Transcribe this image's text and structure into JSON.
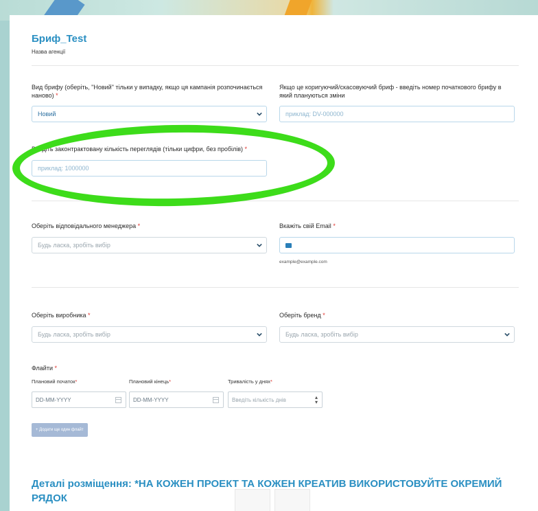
{
  "form": {
    "title": "Бриф_Test",
    "agency_label": "Назва агенції",
    "brief_type": {
      "label": "Вид брифу (оберіть, \"Новий\" тільки у випадку, якщо ця кампанія розпочинається наново)",
      "value": "Новий"
    },
    "corrective_number": {
      "label": "Якщо це коригуючий/скасовуючий бриф - введіть номер початкового брифу в який плануються зміни",
      "placeholder": "приклад: DV-000000"
    },
    "views": {
      "label": "Введіть законтрактовану кількість переглядів (тільки цифри, без пробілів)",
      "placeholder": "приклад: 1000000"
    },
    "manager": {
      "label": "Оберіть відповідального менеджера",
      "placeholder": "Будь ласка, зробіть вибір"
    },
    "email": {
      "label": "Вкажіть свій Email",
      "hint": "example@example.com"
    },
    "producer": {
      "label": "Оберіть виробника",
      "placeholder": "Будь ласка, зробіть вибір"
    },
    "brand": {
      "label": "Оберіть бренд",
      "placeholder": "Будь ласка, зробіть вибір"
    },
    "flights": {
      "label": "Флайти",
      "start_label": "Плановий початок",
      "end_label": "Плановий кінець",
      "duration_label": "Тривалість у днях",
      "date_placeholder": "DD-MM-YYYY",
      "duration_placeholder": "Введіть кількість днів",
      "add_button": "+ Додати ще один флайт"
    },
    "placement_title": "Деталі розміщення: *НА КОЖЕН ПРОЕКТ ТА КОЖЕН КРЕАТИВ ВИКОРИСТОВУЙТЕ ОКРЕМИЙ РЯДОК",
    "required_mark": "*"
  },
  "colors": {
    "accent": "#2a8fc2",
    "required": "#e0352f",
    "highlight": "#3ddc1a"
  }
}
